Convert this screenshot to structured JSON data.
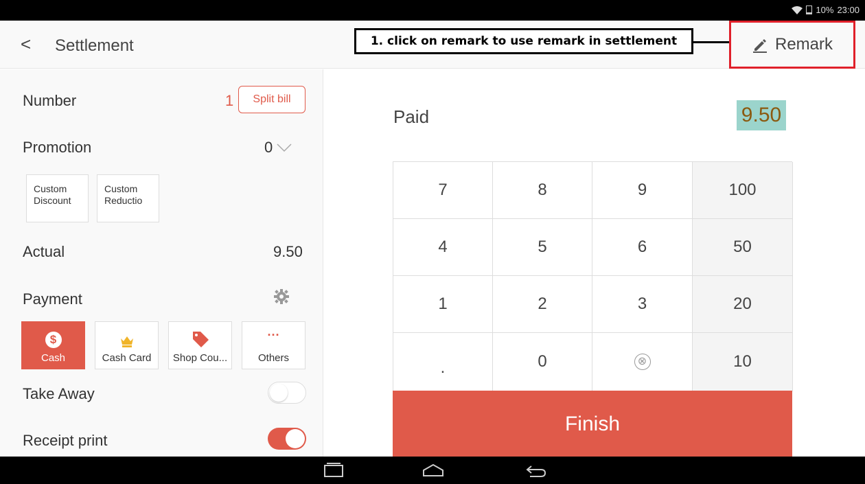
{
  "status_bar": {
    "battery": "10%",
    "time": "23:00"
  },
  "header": {
    "back_icon": "chevron-left-icon",
    "back_glyph": "<",
    "title": "Settlement",
    "annotation": "1. click on remark to use remark in settlement",
    "remark_icon": "pencil-icon",
    "remark_label": "Remark",
    "highlight_color": "#e0202a"
  },
  "left": {
    "number": {
      "label": "Number",
      "value": "1",
      "split_label": "Split bill"
    },
    "promotion": {
      "label": "Promotion",
      "value": "0"
    },
    "discounts": [
      {
        "line1": "Custom",
        "line2": "Discount"
      },
      {
        "line1": "Custom",
        "line2": "Reductio"
      }
    ],
    "actual": {
      "label": "Actual",
      "value": "9.50"
    },
    "payment": {
      "label": "Payment",
      "settings_icon": "gear-icon",
      "methods": [
        {
          "label": "Cash",
          "icon": "dollar-icon",
          "active": true
        },
        {
          "label": "Cash Card",
          "icon": "crown-icon",
          "active": false
        },
        {
          "label": "Shop Cou...",
          "icon": "tag-icon",
          "active": false
        },
        {
          "label": "Others",
          "icon": "more-icon",
          "active": false
        }
      ]
    },
    "take_away": {
      "label": "Take Away",
      "on": false
    },
    "receipt_print": {
      "label": "Receipt print",
      "on": true
    }
  },
  "right": {
    "paid_label": "Paid",
    "paid_value": "9.50",
    "keys": [
      [
        "7",
        "8",
        "9",
        "100"
      ],
      [
        "4",
        "5",
        "6",
        "50"
      ],
      [
        "1",
        "2",
        "3",
        "20"
      ],
      [
        ".",
        "0",
        "⊗",
        "10"
      ]
    ],
    "finish_label": "Finish"
  },
  "colors": {
    "accent": "#e05a4a",
    "paid_highlight": "#9bd4cc"
  }
}
